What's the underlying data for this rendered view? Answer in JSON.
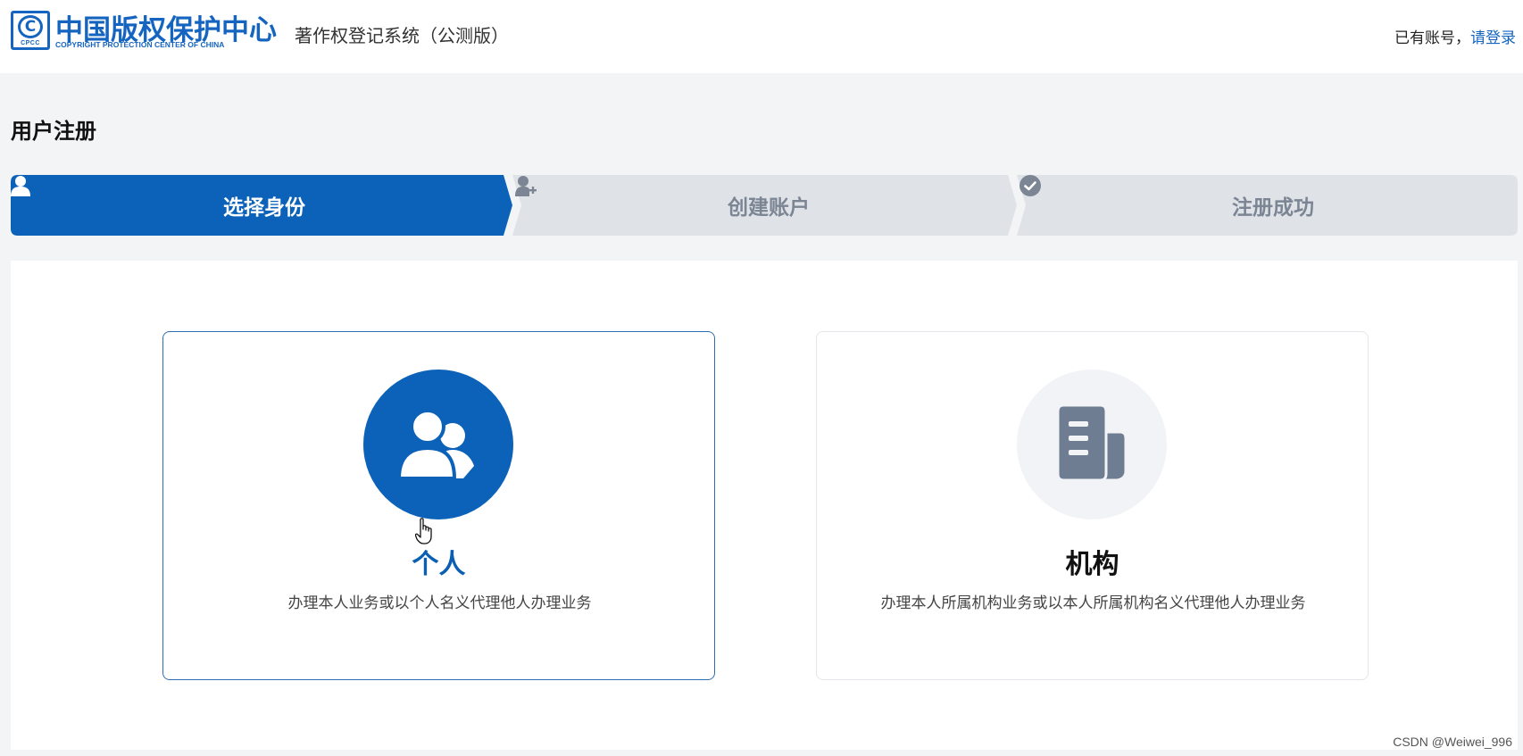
{
  "header": {
    "logo_cn": "中国版权保护中心",
    "logo_en": "COPYRIGHT PROTECTION CENTER OF CHINA",
    "logo_badge": "CPCC",
    "system_title": "著作权登记系统（公测版）",
    "account_text": "已有账号，",
    "login_link": "请登录"
  },
  "page": {
    "title": "用户注册"
  },
  "steps": [
    {
      "label": "选择身份",
      "icon": "user-icon",
      "state": "active"
    },
    {
      "label": "创建账户",
      "icon": "user-add-icon",
      "state": "inactive"
    },
    {
      "label": "注册成功",
      "icon": "check-circle-icon",
      "state": "inactive"
    }
  ],
  "options": [
    {
      "name": "个人",
      "description": "办理本人业务或以个人名义代理他人办理业务",
      "icon": "users-icon",
      "selected": true
    },
    {
      "name": "机构",
      "description": "办理本人所属机构业务或以本人所属机构名义代理他人办理业务",
      "icon": "document-icon",
      "selected": false
    }
  ],
  "watermark": "CSDN @Weiwei_996",
  "colors": {
    "primary": "#0b62b8",
    "step_inactive": "#dfe3e8",
    "step_inactive_text": "#7b8593",
    "page_bg": "#f3f4f6"
  }
}
